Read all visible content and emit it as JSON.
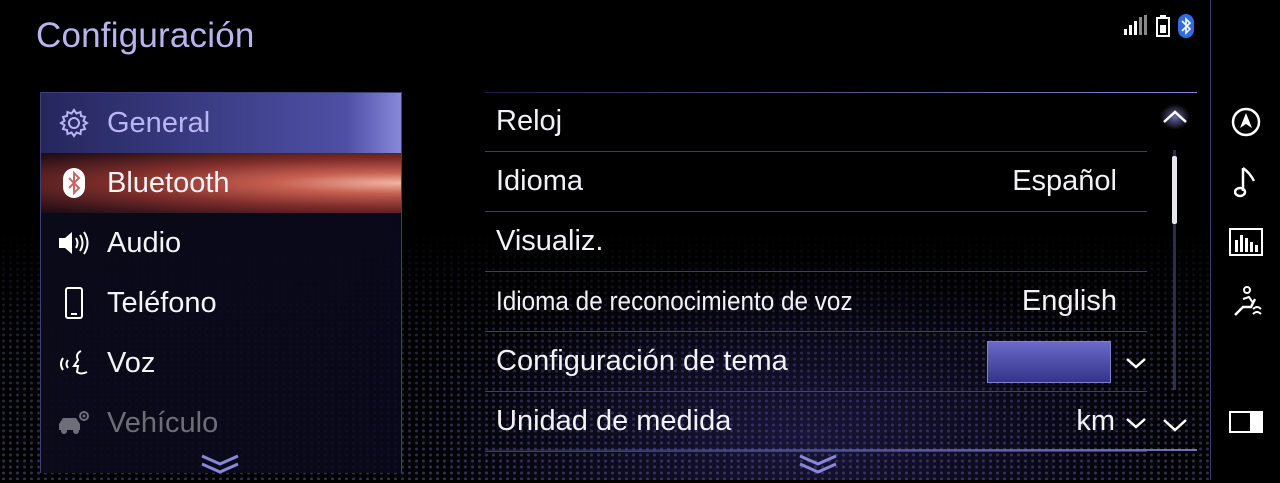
{
  "header": {
    "title": "Configuración",
    "status_icons": [
      "signal-icon",
      "battery-icon",
      "bluetooth-icon"
    ]
  },
  "menu": {
    "items": [
      {
        "label": "General",
        "icon": "gear-icon",
        "state": "selected"
      },
      {
        "label": "Bluetooth",
        "icon": "bluetooth-icon",
        "state": "focused"
      },
      {
        "label": "Audio",
        "icon": "speaker-icon",
        "state": "normal"
      },
      {
        "label": "Teléfono",
        "icon": "phone-icon",
        "state": "normal"
      },
      {
        "label": "Voz",
        "icon": "voice-icon",
        "state": "normal"
      },
      {
        "label": "Vehículo",
        "icon": "vehicle-settings-icon",
        "state": "disabled"
      }
    ],
    "more_indicator": "double-chevron-down-icon"
  },
  "settings": {
    "rows": [
      {
        "label": "Reloj",
        "value": ""
      },
      {
        "label": "Idioma",
        "value": "Español"
      },
      {
        "label": "Visualiz.",
        "value": ""
      },
      {
        "label": "Idioma de reconocimiento de voz",
        "value": "English"
      },
      {
        "label": "Configuración de tema",
        "value": ""
      },
      {
        "label": "Unidad de medida",
        "value": "km"
      }
    ],
    "theme_swatch_color": "#4a4aa8"
  },
  "sidebar": {
    "buttons": [
      "navigation-icon",
      "music-note-icon",
      "equalizer-icon",
      "climate-seat-icon",
      "display-toggle-icon"
    ]
  },
  "colors": {
    "accent": "#b9b4ee",
    "focus_glow": "#e06a55",
    "divider": "#6e70be"
  }
}
